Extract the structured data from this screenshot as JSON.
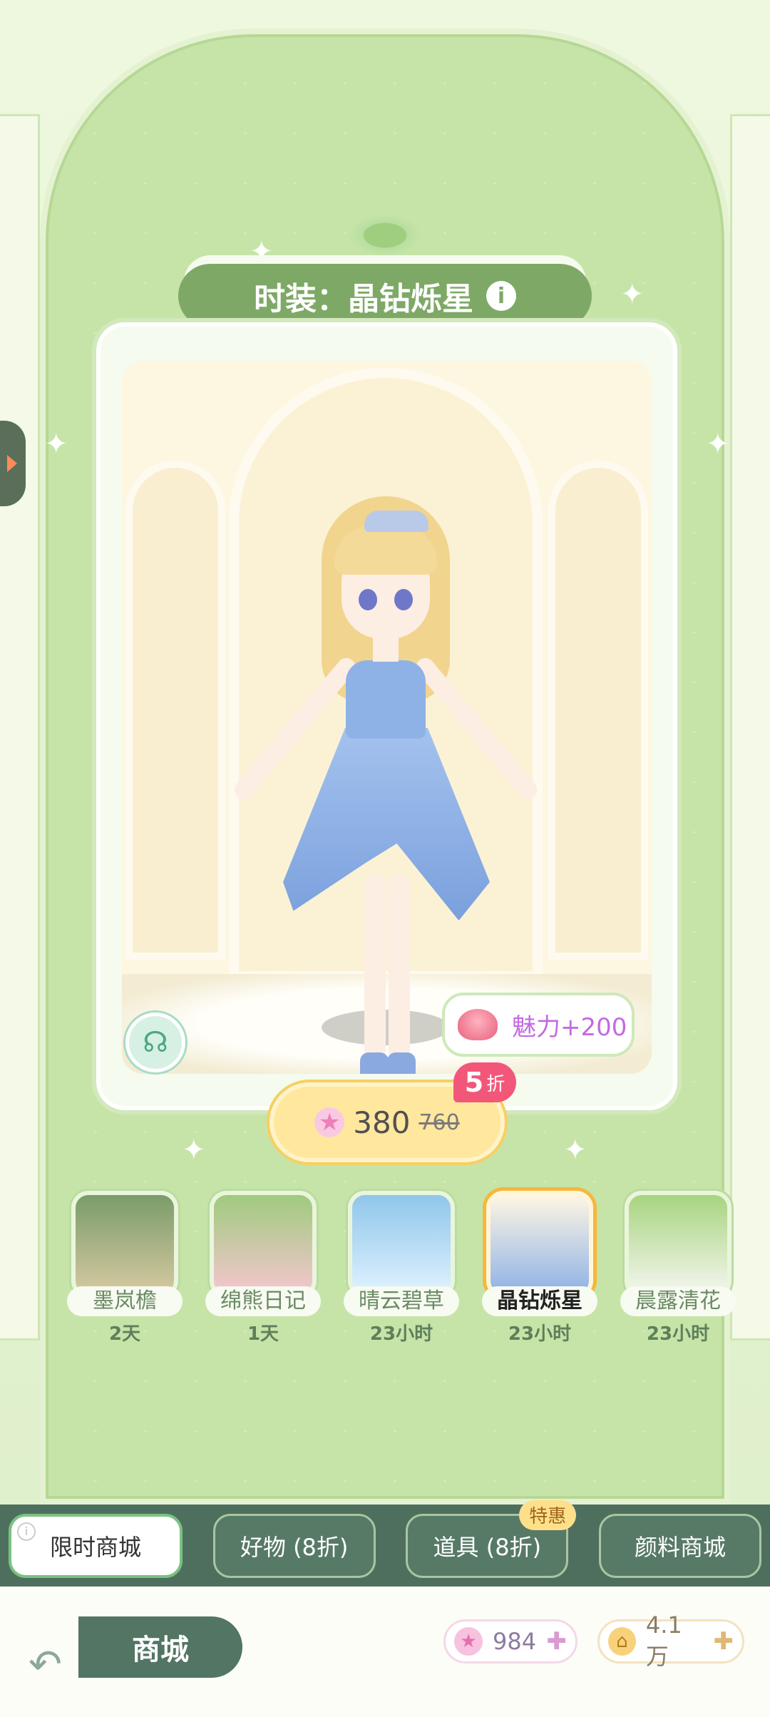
{
  "title": {
    "text": "时装：晶钻烁星",
    "info_icon": "i"
  },
  "charm": {
    "text": "魅力+200",
    "icon": "rose-icon"
  },
  "price": {
    "discount_number": "5",
    "discount_unit": "折",
    "current": "380",
    "original": "760"
  },
  "outfits": [
    {
      "name": "墨岚檐",
      "time": "2天",
      "selected": false
    },
    {
      "name": "绵熊日记",
      "time": "1天",
      "selected": false
    },
    {
      "name": "晴云碧草",
      "time": "23小时",
      "selected": false
    },
    {
      "name": "晶钻烁星",
      "time": "23小时",
      "selected": true
    },
    {
      "name": "晨露清花",
      "time": "23小时",
      "selected": false
    }
  ],
  "tabs": [
    {
      "label": "限时商城",
      "active": true
    },
    {
      "label": "好物 (8折)",
      "active": false
    },
    {
      "label": "道具 (8折)",
      "active": false,
      "badge": "特惠"
    },
    {
      "label": "颜料商城",
      "active": false
    }
  ],
  "bottom": {
    "shop_title": "商城",
    "gems": "984",
    "coins": "4.1万"
  },
  "colors": {
    "accent_green": "#7ea866",
    "selected_border": "#f6b73c",
    "discount_red": "#f2577a",
    "charm_purple": "#c36be0"
  }
}
